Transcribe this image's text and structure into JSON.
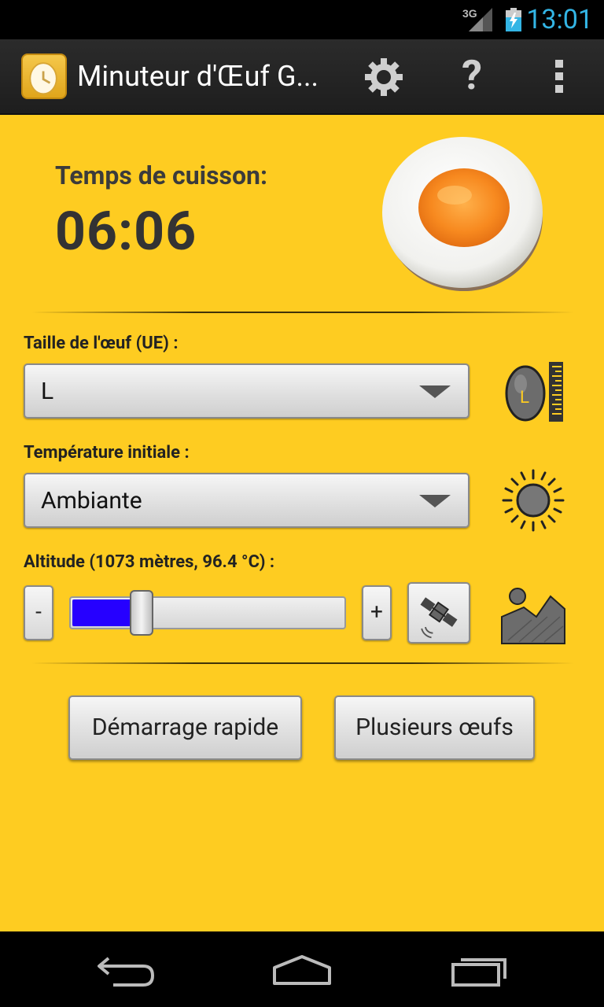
{
  "status_bar": {
    "network": "3G",
    "time": "13:01"
  },
  "action_bar": {
    "title": "Minuteur d'Œuf G...",
    "help_label": "?"
  },
  "cooking": {
    "label": "Temps de cuisson:",
    "time": "06:06"
  },
  "egg_size": {
    "label": "Taille de l'œuf (UE) :",
    "value": "L",
    "icon_letter": "L"
  },
  "start_temp": {
    "label": "Température initiale :",
    "value": "Ambiante"
  },
  "altitude": {
    "label": "Altitude (1073 mètres, 96.4 °C) :",
    "minus": "-",
    "plus": "+",
    "slider_fraction": 0.26
  },
  "buttons": {
    "quick_start": "Démarrage rapide",
    "multiple_eggs": "Plusieurs œufs"
  },
  "colors": {
    "background": "#fecc21",
    "slider_fill": "#2600ff",
    "clock": "#33b5e5"
  }
}
